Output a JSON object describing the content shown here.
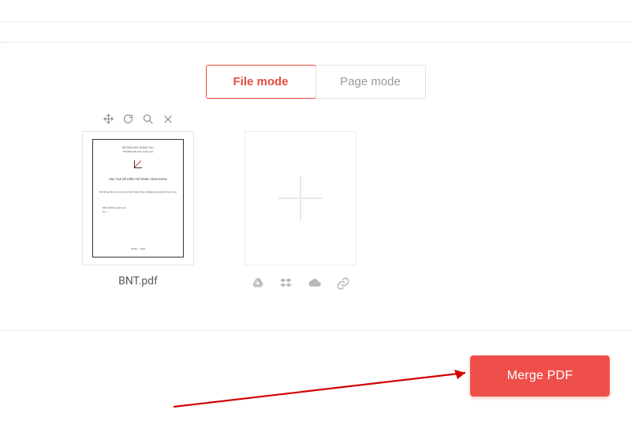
{
  "tabs": {
    "file_mode": "File mode",
    "page_mode": "Page mode"
  },
  "file": {
    "name": "BNT.pdf"
  },
  "action": {
    "merge_label": "Merge PDF"
  }
}
